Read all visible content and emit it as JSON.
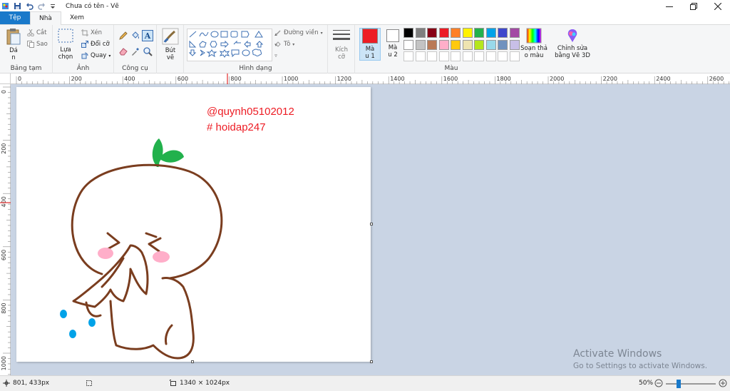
{
  "window": {
    "title": "Chưa có tên - Vẽ",
    "controls": [
      "minimize",
      "restore",
      "close"
    ]
  },
  "tabs": [
    {
      "label": "Tệp"
    },
    {
      "label": "Nhà"
    },
    {
      "label": "Xem"
    }
  ],
  "ribbon": {
    "clipboard": {
      "label": "Bảng tạm",
      "paste": "Dá\nn",
      "cut": "Cắt",
      "copy": "Sao"
    },
    "image": {
      "label": "Ảnh",
      "select": "Lựa\nchọn",
      "crop": "Xén",
      "resize": "Đổi cỡ",
      "rotate": "Quay"
    },
    "tools": {
      "label": "Công cụ"
    },
    "brushes": {
      "label": "Bút\nvẽ"
    },
    "shapes": {
      "label": "Hình dạng",
      "outline": "Đường viền",
      "fill": "Tô"
    },
    "size": {
      "label": "Kích\ncỡ"
    },
    "colors": {
      "label": "Màu",
      "color1": "Mà\nu 1",
      "color2": "Mà\nu 2",
      "edit_colors": "Soạn thả\no màu",
      "edit_3d": "Chỉnh sửa\nbằng Vẽ 3D",
      "color1_value": "#ed1c24",
      "color2_value": "#ffffff",
      "palette_row1": [
        "#000000",
        "#7f7f7f",
        "#880015",
        "#ed1c24",
        "#ff7f27",
        "#fff200",
        "#22b14c",
        "#00a2e8",
        "#3f48cc",
        "#a349a4"
      ],
      "palette_row2": [
        "#ffffff",
        "#c3c3c3",
        "#b97a57",
        "#ffaec9",
        "#ffc90e",
        "#efe4b0",
        "#b5e61d",
        "#99d9ea",
        "#7092be",
        "#c8bfe7"
      ],
      "palette_row3": [
        "#ffffff",
        "#ffffff",
        "#ffffff",
        "#ffffff",
        "#ffffff",
        "#ffffff",
        "#ffffff",
        "#ffffff",
        "#ffffff",
        "#ffffff"
      ]
    }
  },
  "ruler": {
    "h_ticks": [
      "0",
      "200",
      "400",
      "600",
      "800",
      "1000",
      "1200",
      "1400",
      "1600",
      "1800",
      "2000",
      "2200",
      "2400",
      "2600"
    ],
    "v_ticks": [
      "0",
      "200",
      "400",
      "600",
      "800",
      "1000"
    ]
  },
  "canvas": {
    "text_line1": "@quynh05102012",
    "text_line2": "# hoidap247",
    "text_color": "#ed1c24"
  },
  "watermark": {
    "line1": "Activate Windows",
    "line2": "Go to Settings to activate Windows."
  },
  "status": {
    "cursor_pos": "801, 433px",
    "image_size": "1340 × 1024px",
    "zoom": "50%"
  }
}
